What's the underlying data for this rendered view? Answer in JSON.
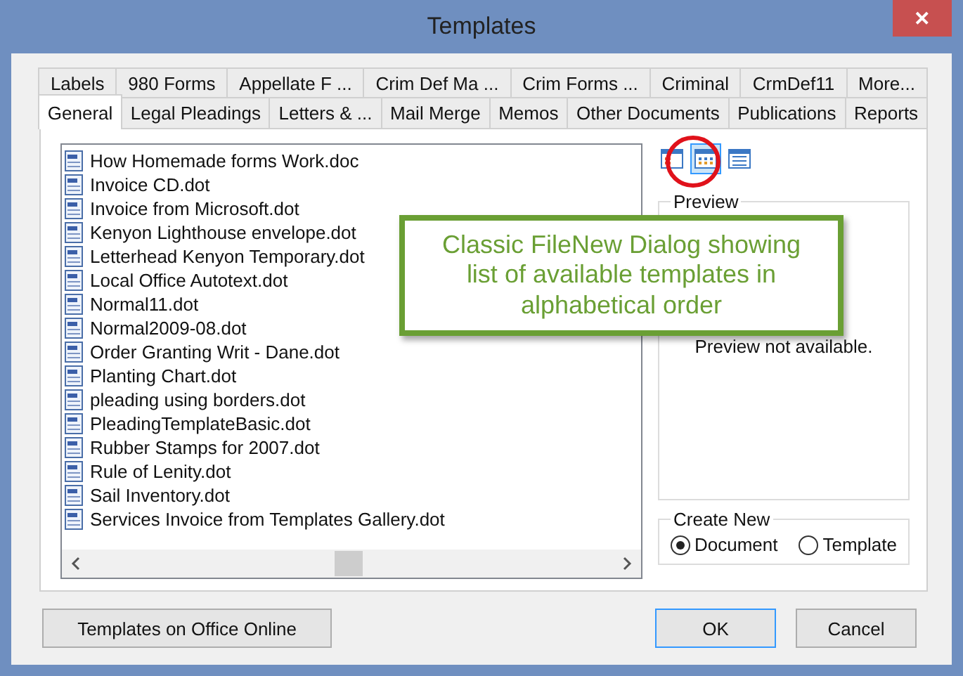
{
  "window": {
    "title": "Templates",
    "close": "✕"
  },
  "tab_rows": [
    [
      {
        "label": "Labels",
        "selected": false
      },
      {
        "label": "980 Forms",
        "selected": false
      },
      {
        "label": "Appellate F ...",
        "selected": false
      },
      {
        "label": "Crim Def Ma ...",
        "selected": false
      },
      {
        "label": "Crim Forms  ...",
        "selected": false
      },
      {
        "label": "Criminal",
        "selected": false
      },
      {
        "label": "CrmDef11",
        "selected": false
      },
      {
        "label": "More...",
        "selected": false
      }
    ],
    [
      {
        "label": "General",
        "selected": true
      },
      {
        "label": "Legal Pleadings",
        "selected": false
      },
      {
        "label": "Letters &  ...",
        "selected": false
      },
      {
        "label": "Mail Merge",
        "selected": false
      },
      {
        "label": "Memos",
        "selected": false
      },
      {
        "label": "Other Documents",
        "selected": false
      },
      {
        "label": "Publications",
        "selected": false
      },
      {
        "label": "Reports",
        "selected": false
      }
    ]
  ],
  "files": [
    "How Homemade forms Work.doc",
    "Invoice CD.dot",
    "Invoice from Microsoft.dot",
    "Kenyon Lighthouse envelope.dot",
    "Letterhead Kenyon Temporary.dot",
    "Local Office Autotext.dot",
    "Normal11.dot",
    "Normal2009-08.dot",
    "Order Granting Writ - Dane.dot",
    "Planting Chart.dot",
    "pleading using borders.dot",
    "PleadingTemplateBasic.dot",
    "Rubber Stamps for 2007.dot",
    "Rule of Lenity.dot",
    "Sail Inventory.dot",
    "Services Invoice from Templates Gallery.dot"
  ],
  "view_buttons": [
    {
      "kind": "large",
      "selected": false
    },
    {
      "kind": "list",
      "selected": true
    },
    {
      "kind": "details",
      "selected": false
    }
  ],
  "preview": {
    "title": "Preview",
    "message": "Preview not available."
  },
  "create_new": {
    "title": "Create New",
    "options": [
      {
        "label": "Document",
        "selected": true
      },
      {
        "label": "Template",
        "selected": false
      }
    ]
  },
  "callout": "Classic FileNew Dialog showing list of available templates in alphabetical order",
  "buttons": {
    "online": "Templates on Office Online",
    "ok": "OK",
    "cancel": "Cancel"
  }
}
